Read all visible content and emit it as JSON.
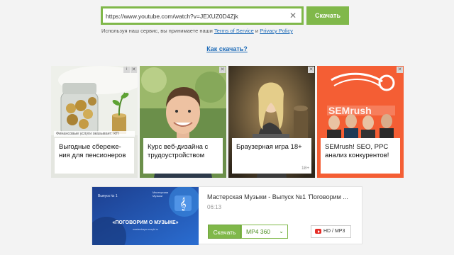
{
  "search": {
    "url_value": "https://www.youtube.com/watch?v=JEXUZ0D4Zjk",
    "clear_glyph": "✕",
    "download_label": "Скачать"
  },
  "terms": {
    "prefix": "Используя наш сервис, вы принимаете наши",
    "tos_link": "Terms of Service",
    "and": "и",
    "privacy_link": "Privacy Policy"
  },
  "howto_link": "Как скачать?",
  "ads": [
    {
      "caption": "Выгодные сбереже­ния для пенсионеров",
      "sponsor": "Финансовые услуги оказывает: КП",
      "close": "✕",
      "info": "i"
    },
    {
      "caption": "Курс веб-дизайна с трудоустройством",
      "close": "✕"
    },
    {
      "caption": "Браузерная игра 18+",
      "age_badge": "18+",
      "close": "✕"
    },
    {
      "caption": "SEMrush! SEO, PPC анализ конкурентов!",
      "close": "✕"
    }
  ],
  "result": {
    "title": "Мастерская Музыки - Выпуск №1 'Поговорим ...",
    "duration": "06:13",
    "download_label": "Скачать",
    "format_label": "MP4 360",
    "format_chevron": "⌄",
    "hd_label": "HD / MP3",
    "thumb": {
      "episode": "Выпуск № 1",
      "brand_line1": "Мастерская",
      "brand_line2": "Музыки",
      "headline": "«ПОГОВОРИМ О МУЗЫКЕ»",
      "site": "masterskaya-muzyki.ru"
    }
  },
  "colors": {
    "accent": "#80b84a",
    "link": "#1e6bb8",
    "background": "#f3f3f3"
  }
}
